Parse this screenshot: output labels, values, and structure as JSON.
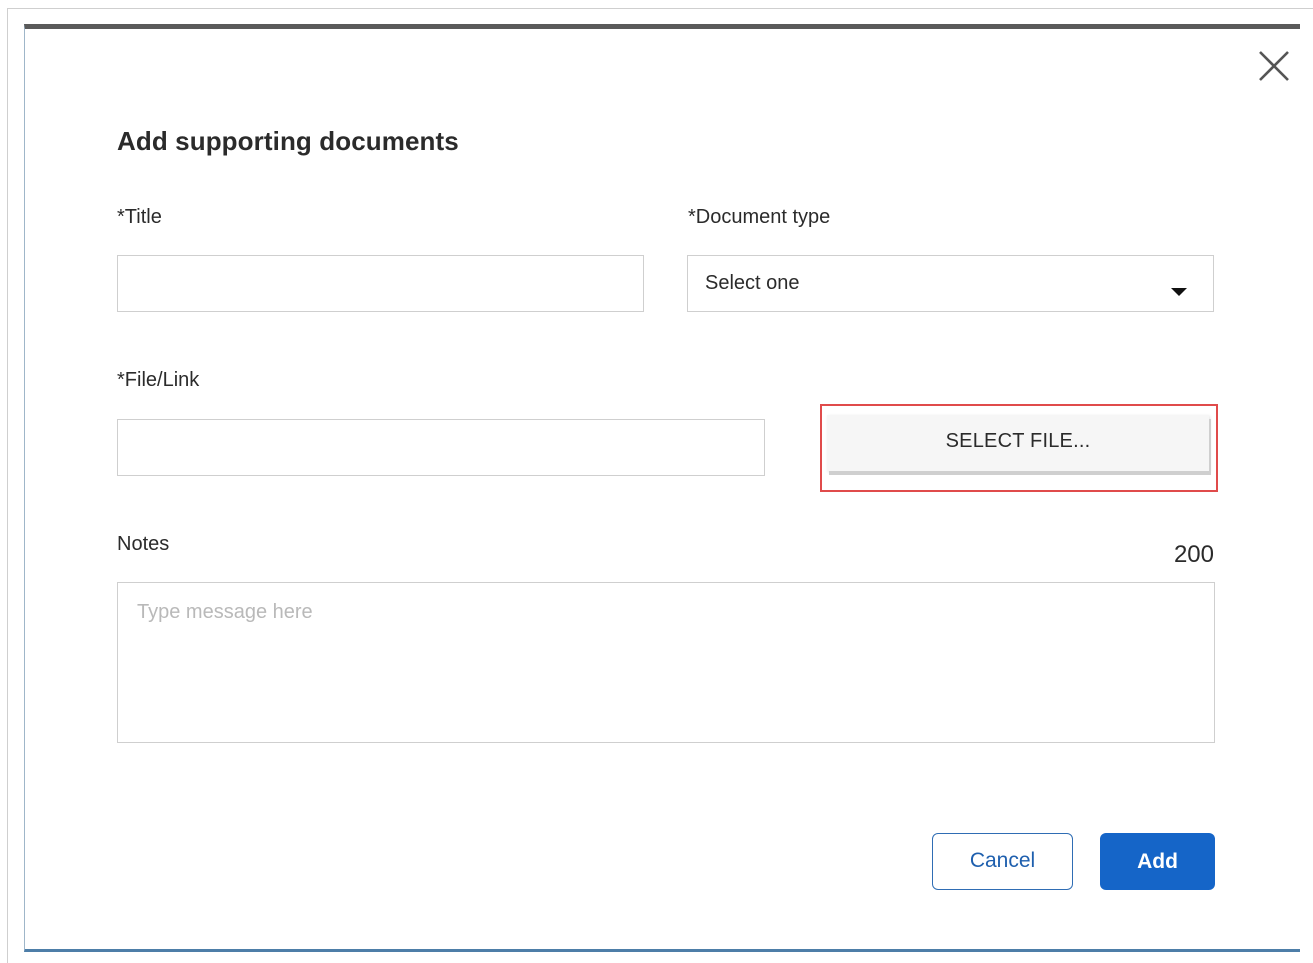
{
  "dialog": {
    "title": "Add supporting documents"
  },
  "fields": {
    "title": {
      "label": "*Title",
      "value": ""
    },
    "document_type": {
      "label": "*Document type",
      "selected": "Select one"
    },
    "file_link": {
      "label": "*File/Link",
      "value": "",
      "select_file_label": "SELECT FILE..."
    },
    "notes": {
      "label": "Notes",
      "placeholder": "Type message here",
      "char_remaining": "200"
    }
  },
  "actions": {
    "cancel_label": "Cancel",
    "add_label": "Add"
  },
  "colors": {
    "primary": "#1565c8",
    "highlight": "#e04b4b",
    "border": "#cfcfcf"
  },
  "icons": {
    "close": "close-icon",
    "dropdown": "chevron-down-icon"
  }
}
